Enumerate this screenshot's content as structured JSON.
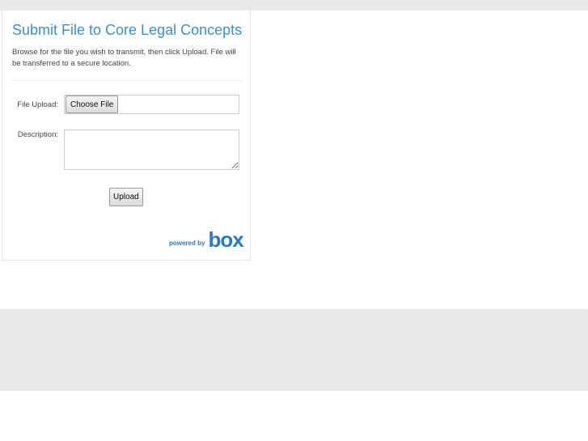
{
  "title": "Submit File to Core Legal Concepts",
  "intro": "Browse for the file you wish to transmit, then click Upload. File will be transferred to a secure location.",
  "form": {
    "file_label": "File Upload:",
    "choose_label": "Choose File",
    "description_label": "Description:",
    "description_value": "",
    "upload_label": "Upload"
  },
  "footer": {
    "powered_by": "powered by",
    "brand": "box"
  }
}
